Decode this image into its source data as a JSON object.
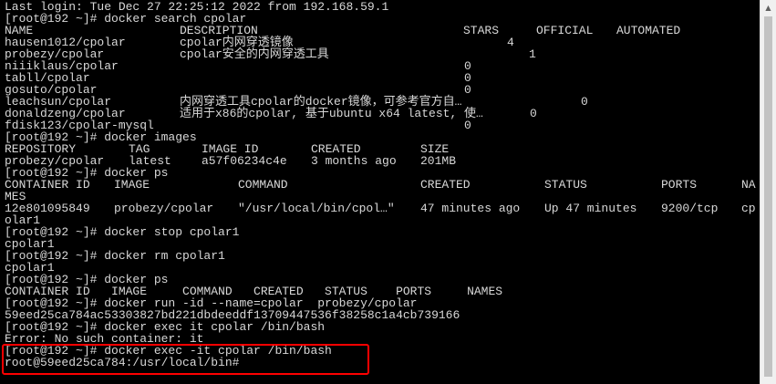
{
  "terminal": {
    "login": "Last login: Tue Dec 27 22:25:12 2022 from 192.168.59.1",
    "cmd_search": "[root@192 ~]# docker search cpolar",
    "search_table": {
      "headers": [
        "NAME",
        "DESCRIPTION",
        "STARS",
        "OFFICIAL",
        "AUTOMATED"
      ],
      "rows": [
        {
          "name": "hausen1012/cpolar",
          "description": "cpolar内网穿透镜像",
          "stars": "4"
        },
        {
          "name": "probezy/cpolar",
          "description": "cpolar安全的内网穿透工具",
          "stars": "1"
        },
        {
          "name": "niiiklaus/cpolar",
          "description": "",
          "stars": "0"
        },
        {
          "name": "tabll/cpolar",
          "description": "",
          "stars": "0"
        },
        {
          "name": "gosuto/cpolar",
          "description": "",
          "stars": "0"
        },
        {
          "name": "leachsun/cpolar",
          "description": "内网穿透工具cpolar的docker镜像，可参考官方自…",
          "stars": "0"
        },
        {
          "name": "donaldzeng/cpolar",
          "description": "适用于x86的cpolar, 基于ubuntu x64 latest, 使…",
          "stars": "0"
        },
        {
          "name": "fdisk123/cpolar-mysql",
          "description": "",
          "stars": "0"
        }
      ]
    },
    "cmd_images": "[root@192 ~]# docker images",
    "images_table": {
      "headers": [
        "REPOSITORY",
        "TAG",
        "IMAGE ID",
        "CREATED",
        "SIZE"
      ],
      "row": [
        "probezy/cpolar",
        "latest",
        "a57f06234c4e",
        "3 months ago",
        "201MB"
      ]
    },
    "cmd_ps1": "[root@192 ~]# docker ps",
    "ps_table": {
      "headers": [
        "CONTAINER ID",
        "IMAGE",
        "COMMAND",
        "CREATED",
        "STATUS",
        "PORTS",
        "NA"
      ],
      "header_wrap": "MES",
      "row": [
        "12e801095849",
        "probezy/cpolar",
        "\"/usr/local/bin/cpol…\"",
        "47 minutes ago",
        "Up 47 minutes",
        "9200/tcp",
        "cp"
      ],
      "row_wrap": "olar1"
    },
    "cmd_stop": "[root@192 ~]# docker stop cpolar1",
    "out_stop": "cpolar1",
    "cmd_rm": "[root@192 ~]# docker rm cpolar1",
    "out_rm": "cpolar1",
    "cmd_ps2": "[root@192 ~]# docker ps",
    "ps_empty_header": "CONTAINER ID   IMAGE     COMMAND   CREATED   STATUS    PORTS     NAMES",
    "cmd_run": "[root@192 ~]# docker run -id --name=cpolar  probezy/cpolar",
    "out_run": "59eed25ca784ac53303827bd221dbdeeddf13709447536f38258c1a4cb739166",
    "cmd_exec1": "[root@192 ~]# docker exec it cpolar /bin/bash",
    "out_exec1": "Error: No such container: it",
    "cmd_exec2": "[root@192 ~]# docker exec -it cpolar /bin/bash",
    "prompt_container": "root@59eed25ca784:/usr/local/bin#"
  },
  "colors": {
    "background": "#000000",
    "text": "#d8d8d8",
    "highlight": "#ff0000"
  }
}
